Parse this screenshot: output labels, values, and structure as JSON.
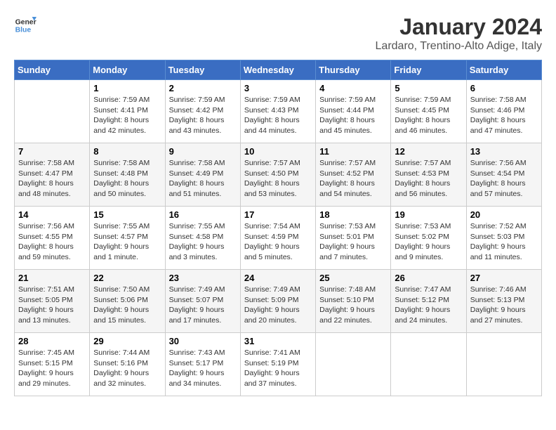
{
  "logo": {
    "line1": "General",
    "line2": "Blue"
  },
  "title": "January 2024",
  "location": "Lardaro, Trentino-Alto Adige, Italy",
  "days_header": [
    "Sunday",
    "Monday",
    "Tuesday",
    "Wednesday",
    "Thursday",
    "Friday",
    "Saturday"
  ],
  "weeks": [
    [
      {
        "day": "",
        "info": ""
      },
      {
        "day": "1",
        "info": "Sunrise: 7:59 AM\nSunset: 4:41 PM\nDaylight: 8 hours\nand 42 minutes."
      },
      {
        "day": "2",
        "info": "Sunrise: 7:59 AM\nSunset: 4:42 PM\nDaylight: 8 hours\nand 43 minutes."
      },
      {
        "day": "3",
        "info": "Sunrise: 7:59 AM\nSunset: 4:43 PM\nDaylight: 8 hours\nand 44 minutes."
      },
      {
        "day": "4",
        "info": "Sunrise: 7:59 AM\nSunset: 4:44 PM\nDaylight: 8 hours\nand 45 minutes."
      },
      {
        "day": "5",
        "info": "Sunrise: 7:59 AM\nSunset: 4:45 PM\nDaylight: 8 hours\nand 46 minutes."
      },
      {
        "day": "6",
        "info": "Sunrise: 7:58 AM\nSunset: 4:46 PM\nDaylight: 8 hours\nand 47 minutes."
      }
    ],
    [
      {
        "day": "7",
        "info": "Sunrise: 7:58 AM\nSunset: 4:47 PM\nDaylight: 8 hours\nand 48 minutes."
      },
      {
        "day": "8",
        "info": "Sunrise: 7:58 AM\nSunset: 4:48 PM\nDaylight: 8 hours\nand 50 minutes."
      },
      {
        "day": "9",
        "info": "Sunrise: 7:58 AM\nSunset: 4:49 PM\nDaylight: 8 hours\nand 51 minutes."
      },
      {
        "day": "10",
        "info": "Sunrise: 7:57 AM\nSunset: 4:50 PM\nDaylight: 8 hours\nand 53 minutes."
      },
      {
        "day": "11",
        "info": "Sunrise: 7:57 AM\nSunset: 4:52 PM\nDaylight: 8 hours\nand 54 minutes."
      },
      {
        "day": "12",
        "info": "Sunrise: 7:57 AM\nSunset: 4:53 PM\nDaylight: 8 hours\nand 56 minutes."
      },
      {
        "day": "13",
        "info": "Sunrise: 7:56 AM\nSunset: 4:54 PM\nDaylight: 8 hours\nand 57 minutes."
      }
    ],
    [
      {
        "day": "14",
        "info": "Sunrise: 7:56 AM\nSunset: 4:55 PM\nDaylight: 8 hours\nand 59 minutes."
      },
      {
        "day": "15",
        "info": "Sunrise: 7:55 AM\nSunset: 4:57 PM\nDaylight: 9 hours\nand 1 minute."
      },
      {
        "day": "16",
        "info": "Sunrise: 7:55 AM\nSunset: 4:58 PM\nDaylight: 9 hours\nand 3 minutes."
      },
      {
        "day": "17",
        "info": "Sunrise: 7:54 AM\nSunset: 4:59 PM\nDaylight: 9 hours\nand 5 minutes."
      },
      {
        "day": "18",
        "info": "Sunrise: 7:53 AM\nSunset: 5:01 PM\nDaylight: 9 hours\nand 7 minutes."
      },
      {
        "day": "19",
        "info": "Sunrise: 7:53 AM\nSunset: 5:02 PM\nDaylight: 9 hours\nand 9 minutes."
      },
      {
        "day": "20",
        "info": "Sunrise: 7:52 AM\nSunset: 5:03 PM\nDaylight: 9 hours\nand 11 minutes."
      }
    ],
    [
      {
        "day": "21",
        "info": "Sunrise: 7:51 AM\nSunset: 5:05 PM\nDaylight: 9 hours\nand 13 minutes."
      },
      {
        "day": "22",
        "info": "Sunrise: 7:50 AM\nSunset: 5:06 PM\nDaylight: 9 hours\nand 15 minutes."
      },
      {
        "day": "23",
        "info": "Sunrise: 7:49 AM\nSunset: 5:07 PM\nDaylight: 9 hours\nand 17 minutes."
      },
      {
        "day": "24",
        "info": "Sunrise: 7:49 AM\nSunset: 5:09 PM\nDaylight: 9 hours\nand 20 minutes."
      },
      {
        "day": "25",
        "info": "Sunrise: 7:48 AM\nSunset: 5:10 PM\nDaylight: 9 hours\nand 22 minutes."
      },
      {
        "day": "26",
        "info": "Sunrise: 7:47 AM\nSunset: 5:12 PM\nDaylight: 9 hours\nand 24 minutes."
      },
      {
        "day": "27",
        "info": "Sunrise: 7:46 AM\nSunset: 5:13 PM\nDaylight: 9 hours\nand 27 minutes."
      }
    ],
    [
      {
        "day": "28",
        "info": "Sunrise: 7:45 AM\nSunset: 5:15 PM\nDaylight: 9 hours\nand 29 minutes."
      },
      {
        "day": "29",
        "info": "Sunrise: 7:44 AM\nSunset: 5:16 PM\nDaylight: 9 hours\nand 32 minutes."
      },
      {
        "day": "30",
        "info": "Sunrise: 7:43 AM\nSunset: 5:17 PM\nDaylight: 9 hours\nand 34 minutes."
      },
      {
        "day": "31",
        "info": "Sunrise: 7:41 AM\nSunset: 5:19 PM\nDaylight: 9 hours\nand 37 minutes."
      },
      {
        "day": "",
        "info": ""
      },
      {
        "day": "",
        "info": ""
      },
      {
        "day": "",
        "info": ""
      }
    ]
  ]
}
